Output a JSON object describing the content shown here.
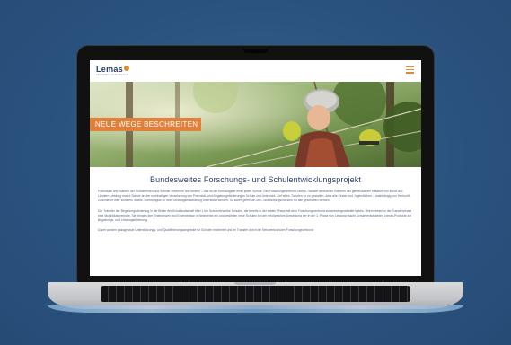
{
  "site": {
    "logo_text": "Lemas",
    "logo_tagline": "LEISTUNG macht SCHULE"
  },
  "hero": {
    "banner": "NEUE WEGE BESCHREITEN"
  },
  "content": {
    "headline": "Bundesweites Forschungs- und Schulentwicklungsprojekt",
    "paragraph_1": "Potenziale und Stärken der Schülerinnen und Schüler erkennen und fördern – das ist die Kernaufgabe einer jeden Schule. Der Forschungsverbund Lemas-Transfer arbeitet im Rahmen der gemeinsamen Initiative von Bund und Ländern Leistung macht Schule an der nachhaltigen Verankerung von Potenzial- und Begabungsförderung in Schule und Unterricht. Ziel ist es, Schulen so zu gestalten, dass alle Kinder und Jugendlichen – unabhängig von Herkunft, Geschlecht oder sozialem Status – bestmöglich in ihrer Leistungsentwicklung unterstützt werden. So sollen gerechte Lern- und Bildungschancen für alle geschaffen werden.",
    "paragraph_2": "Der Transfer der Begabungsförderung in die Breite der Schullandschaft führt 1 bei Schulnetzwerke Schulen, die bereits in der ersten Phase mit dem Forschungsverbund zusammengearbeitet haben. Übernehmen in der Transferphase eine Multiplikatorenrolle. Sie bringen ihre Erfahrungen und Erkenntnisse in Netzwerke ein und begleiten neue Schulen bei der erfolgreichen Umsetzung der in der 1. Phase von Leistung macht Schule entwickelten Lemas-Produkte zur Begabungs- und Leistungsförderung.",
    "paragraph_3": "Dabei wurden passgenaue Unterstützungs- und Qualifizierungsangebote für Schulen erarbeitet und im Transfer durch die Netzwerkschulen Forschungsverbund"
  },
  "colors": {
    "background": "#2d5680",
    "accent": "#e0803a",
    "heading": "#2a3d6b"
  },
  "icons": {
    "menu": "hamburger-menu-icon",
    "logo_mark": "sun-flower-icon"
  }
}
